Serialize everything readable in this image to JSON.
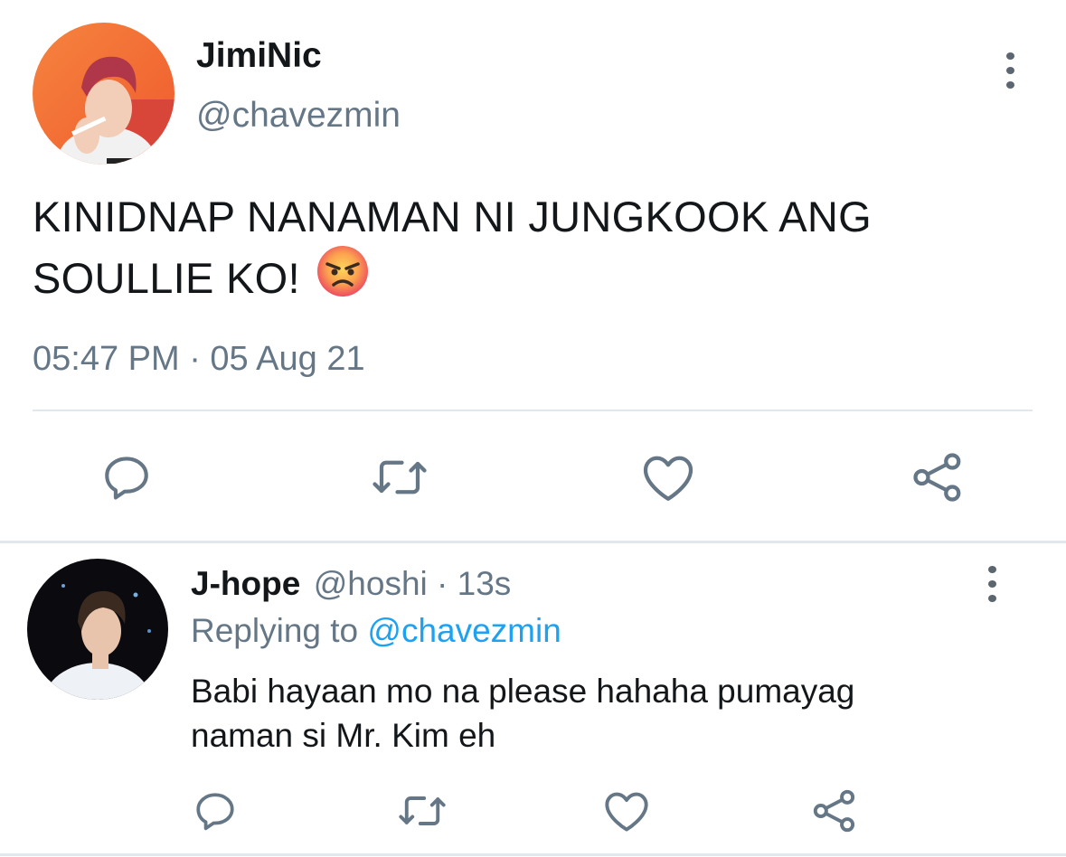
{
  "main_tweet": {
    "author_name": "JimiNic",
    "author_handle": "@chavezmin",
    "text_line1": "KINIDNAP NANAMAN NI JUNGKOOK ANG",
    "text_line2": "SOULLIE KO!",
    "emoji": "angry-face-emoji",
    "timestamp": "05:47 PM · 05 Aug 21",
    "actions": [
      "reply-icon",
      "retweet-icon",
      "like-icon",
      "share-icon"
    ]
  },
  "reply_tweet": {
    "author_name": "J-hope",
    "author_handle": "@hoshi",
    "separator": " · ",
    "time_ago": "13s",
    "replying_prefix": "Replying to ",
    "replying_to": "@chavezmin",
    "text_line1": "Babi hayaan mo na please hahaha pumayag",
    "text_line2": "naman si Mr. Kim eh",
    "actions": [
      "reply-icon",
      "retweet-icon",
      "like-icon",
      "share-icon"
    ]
  },
  "colors": {
    "text": "#14171a",
    "secondary": "#657786",
    "link": "#1da1f2",
    "divider": "#e1e8ed",
    "icon": "#657786"
  }
}
